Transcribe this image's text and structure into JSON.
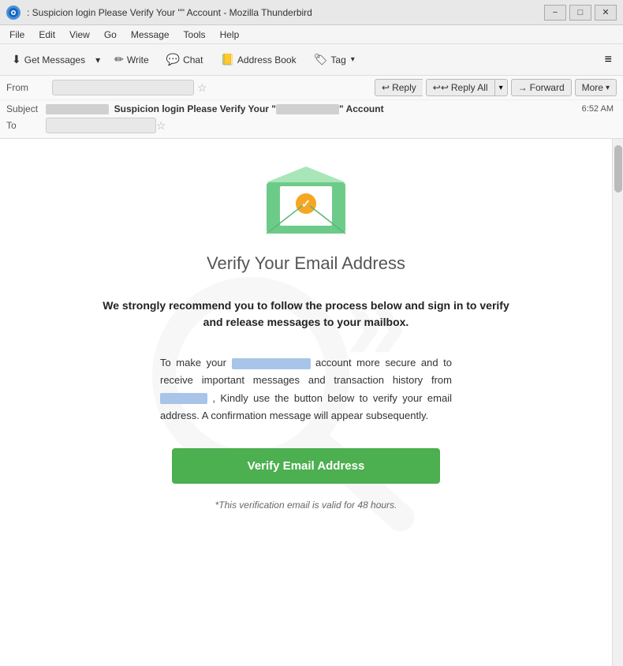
{
  "titleBar": {
    "title": ": Suspicion login Please Verify Your \"\" Account - Mozilla Thunderbird",
    "controls": {
      "minimize": "−",
      "maximize": "□",
      "close": "✕"
    }
  },
  "menuBar": {
    "items": [
      "File",
      "Edit",
      "View",
      "Go",
      "Message",
      "Tools",
      "Help"
    ]
  },
  "toolbar": {
    "getMessages": "Get Messages",
    "write": "Write",
    "chat": "Chat",
    "addressBook": "Address Book",
    "tag": "Tag",
    "hamburger": "≡"
  },
  "emailHeader": {
    "fromLabel": "From",
    "fromAddress": "",
    "subjectLabel": "Subject",
    "subjectPrefix": "Suspicion login Please Verify Your \"",
    "subjectMiddle": "",
    "subjectSuffix": "\" Account",
    "toLabel": "To",
    "toAddress": "",
    "timestamp": "6:52 AM",
    "actions": {
      "reply": "Reply",
      "replyAll": "Reply All",
      "forward": "Forward",
      "more": "More"
    }
  },
  "emailBody": {
    "envelopeAlt": "email envelope icon",
    "title": "Verify Your Email Address",
    "strongText": "We strongly recommend you to follow the process below and sign in to verify\nand release messages to your mailbox.",
    "bodyText1": "To make your",
    "bodyBlur1": "blurred email",
    "bodyText2": "account more secure and to receive important messages and transaction history from",
    "bodyBlur2": "blurred sender",
    "bodyText3": ", Kindly use the button below to verify your email address. A confirmation message will appear subsequently.",
    "verifyButton": "Verify Email Address",
    "validityNote": "*This verification email is valid for 48 hours."
  }
}
